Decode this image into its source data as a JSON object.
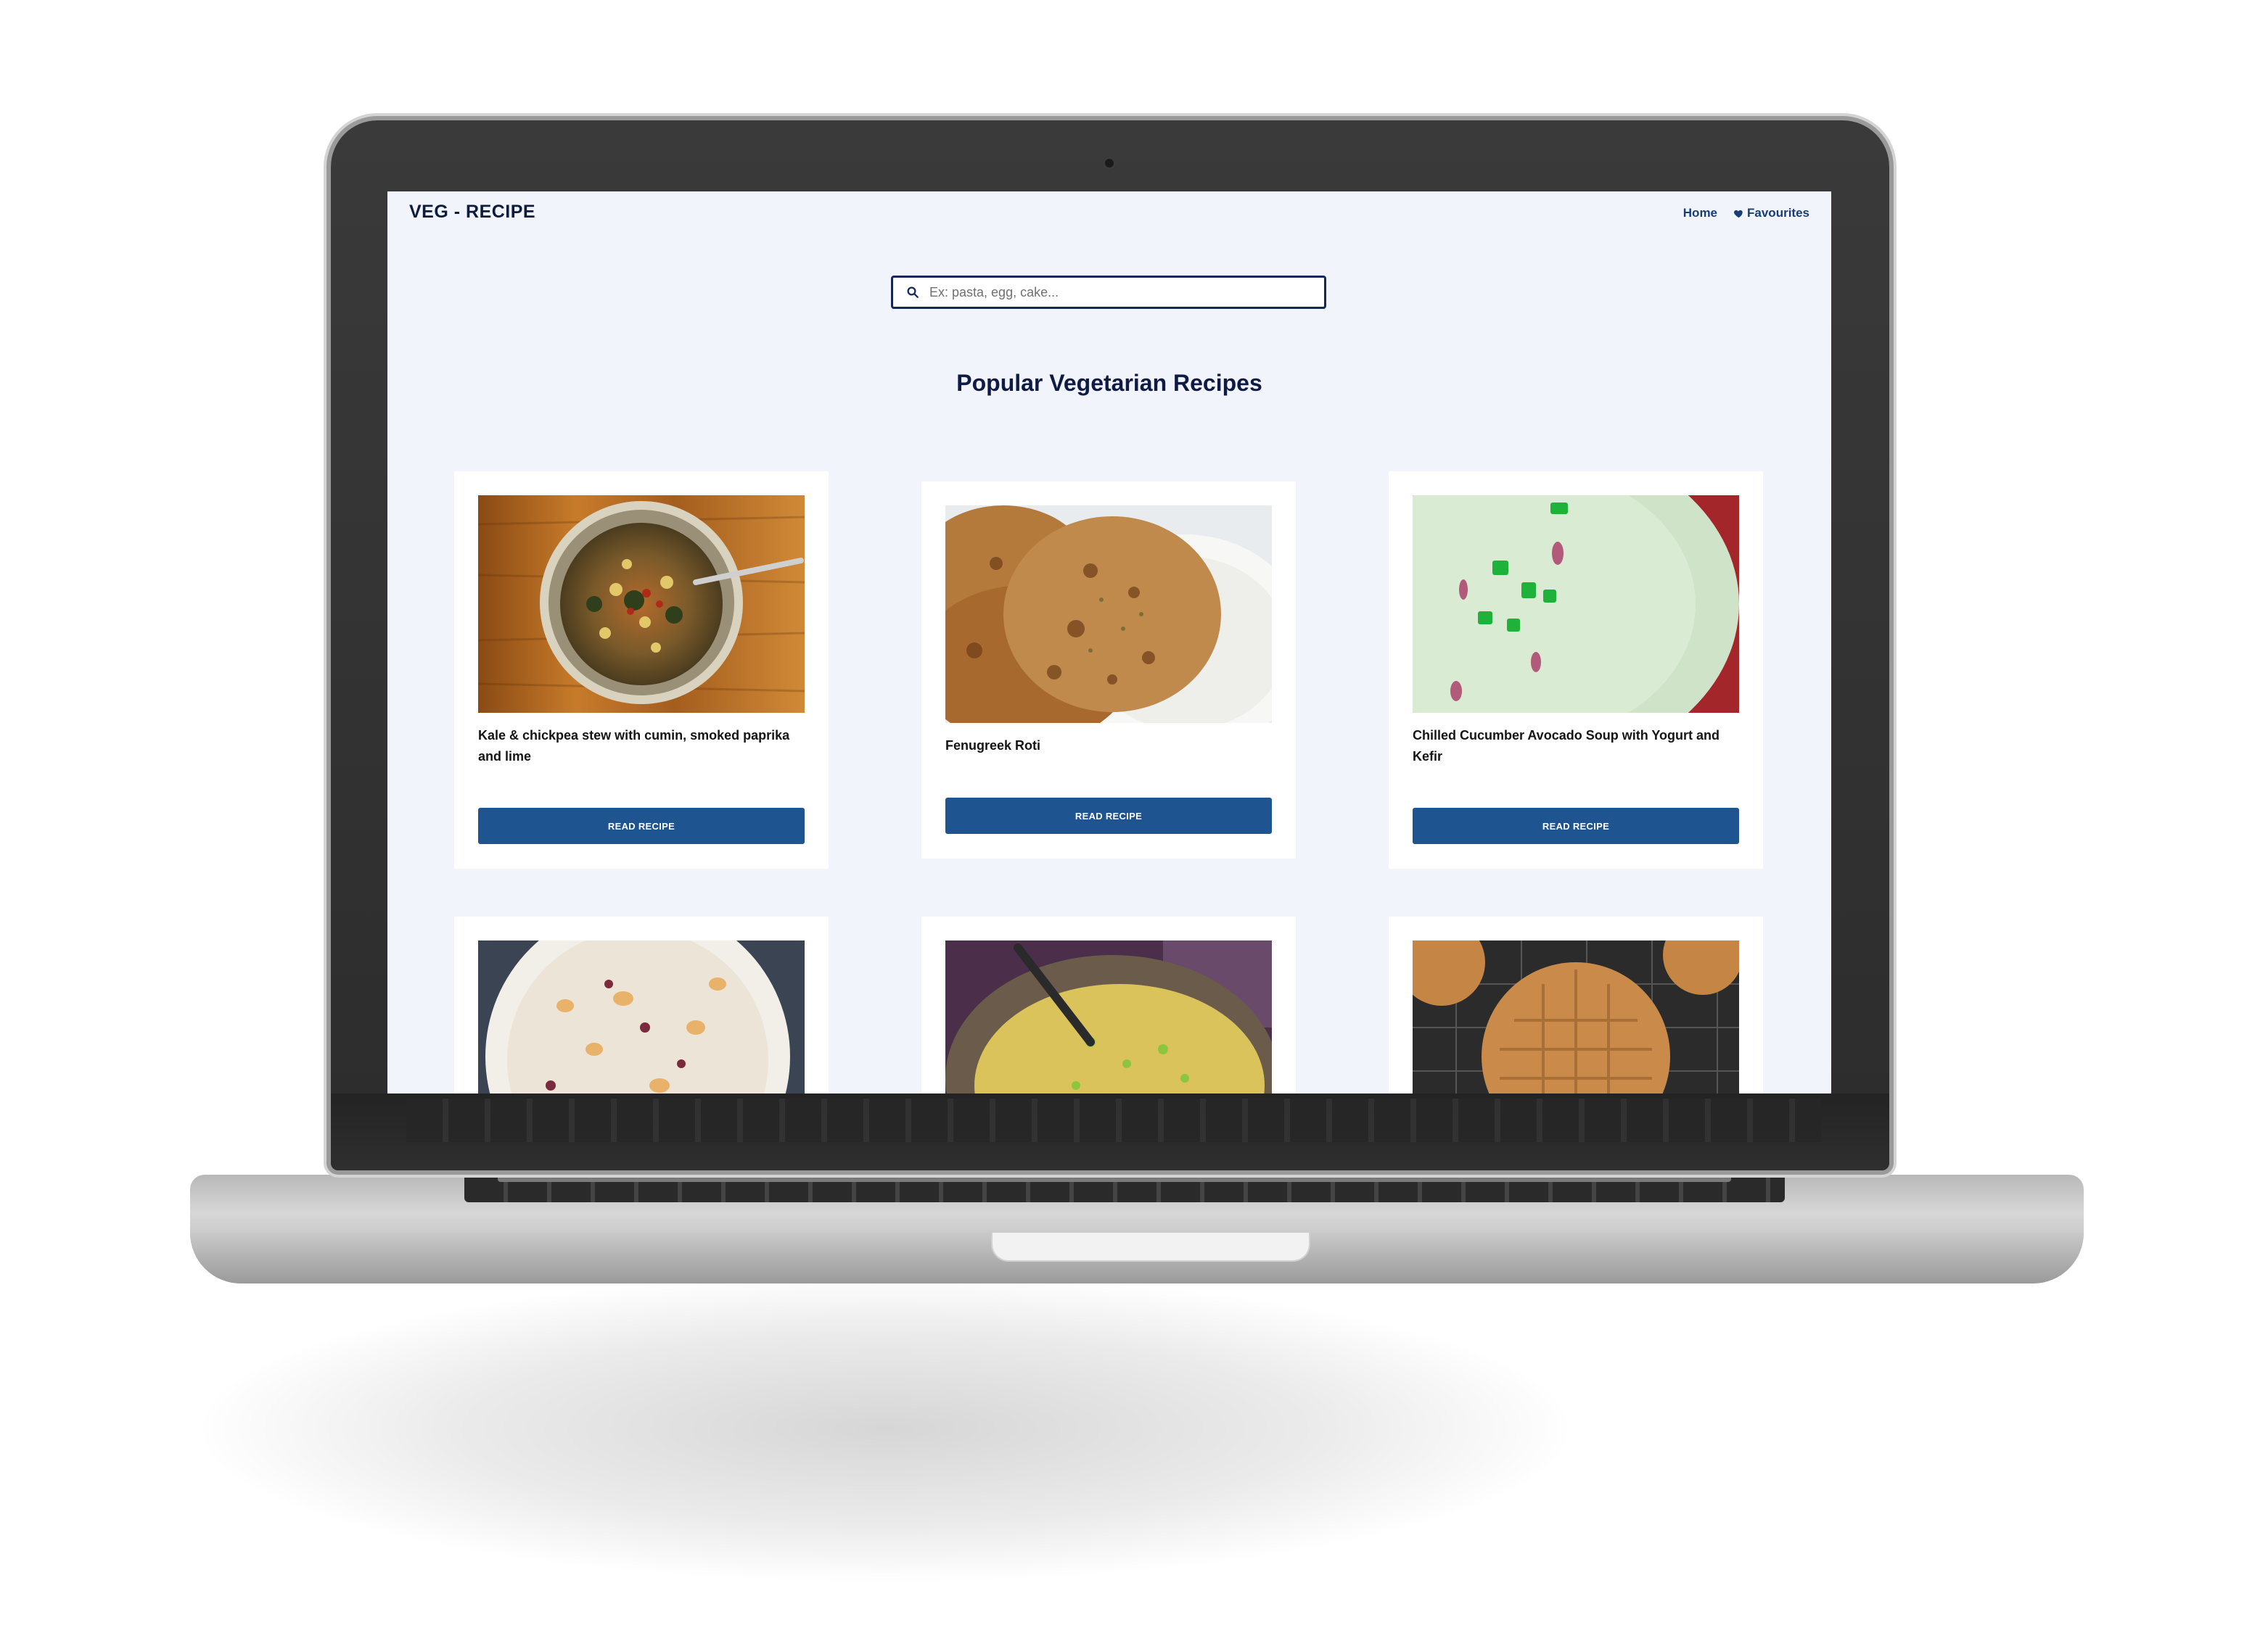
{
  "header": {
    "logo": "VEG - RECIPE",
    "nav": {
      "home": "Home",
      "favourites": "Favourites"
    }
  },
  "search": {
    "placeholder": "Ex: pasta, egg, cake..."
  },
  "main": {
    "heading": "Popular Vegetarian Recipes",
    "cards": [
      {
        "title": "Kale & chickpea stew with cumin, smoked paprika and lime",
        "button": "READ RECIPE",
        "image": "stew-bowl-photo"
      },
      {
        "title": "Fenugreek Roti",
        "button": "READ RECIPE",
        "image": "roti-flatbread-photo"
      },
      {
        "title": "Chilled Cucumber Avocado Soup with Yogurt and Kefir",
        "button": "READ RECIPE",
        "image": "green-soup-photo"
      },
      {
        "title": "",
        "button": "",
        "image": "oat-bowl-photo"
      },
      {
        "title": "",
        "button": "",
        "image": "quinoa-salad-photo"
      },
      {
        "title": "",
        "button": "",
        "image": "peanut-cookies-photo"
      }
    ]
  },
  "colors": {
    "accent": "#1e5590",
    "background": "#f1f5fb",
    "heading": "#0f1b44"
  },
  "icons": {
    "search": "search-icon",
    "favourites": "heart-icon"
  }
}
